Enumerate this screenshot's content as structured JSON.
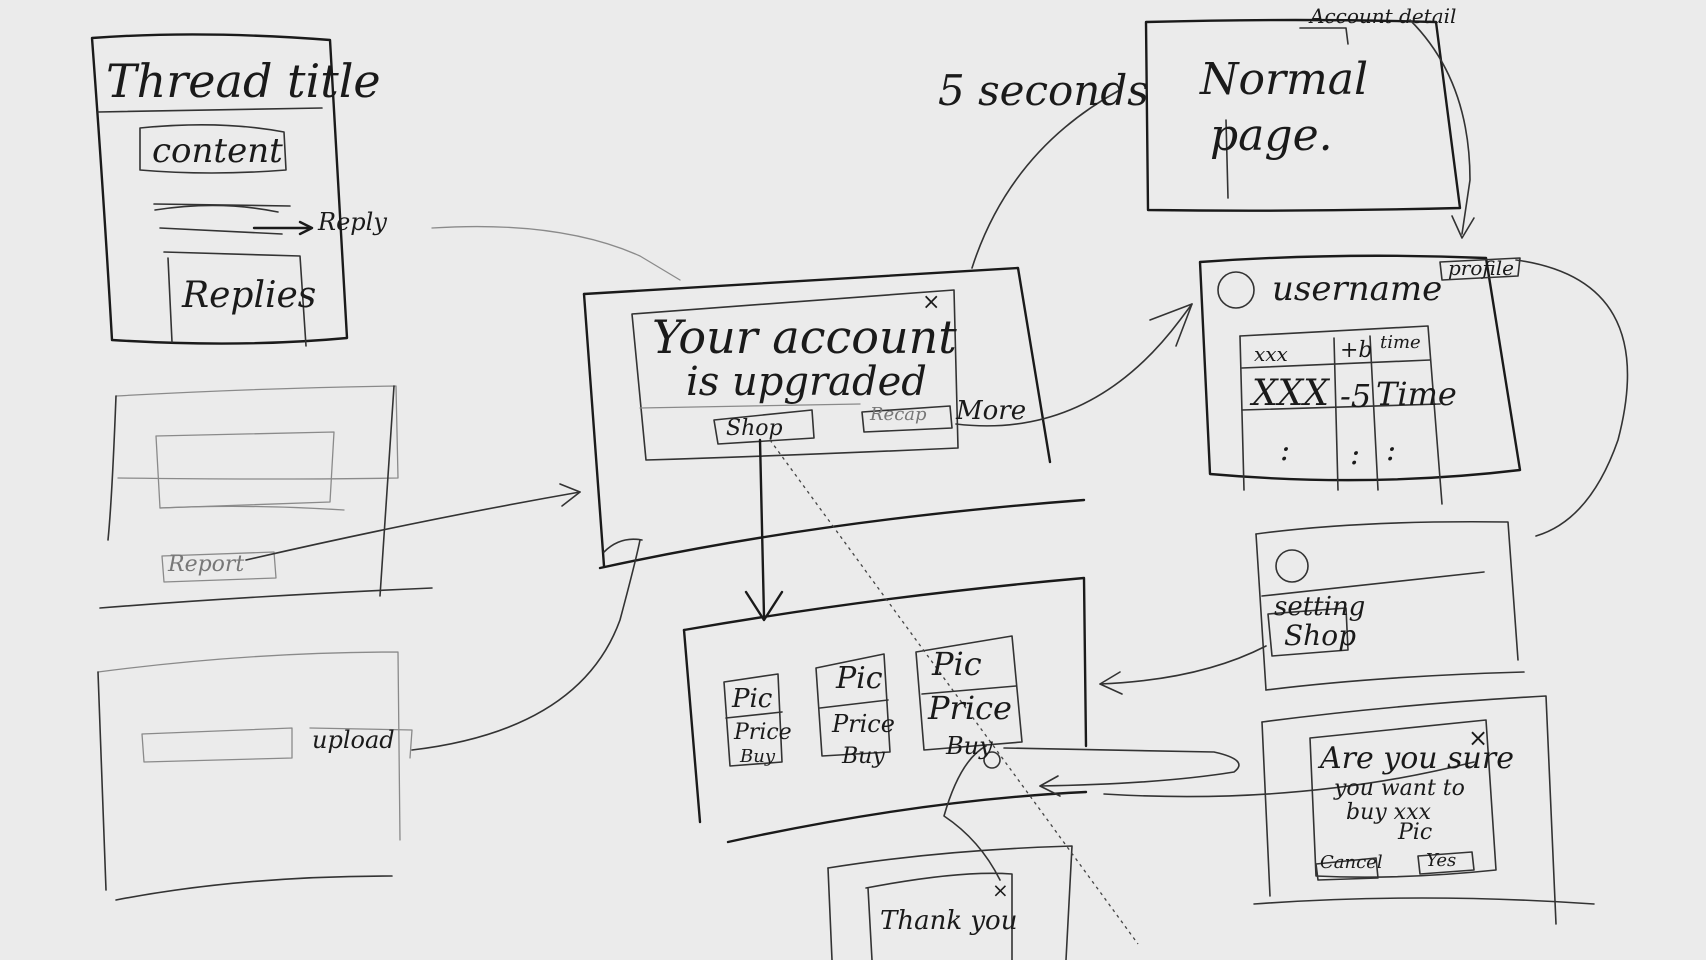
{
  "thread_page": {
    "title": "Thread title",
    "content": "content",
    "reply": "Reply",
    "replies": "Replies"
  },
  "report_page": {
    "report": "Report"
  },
  "upload_page": {
    "upload": "upload"
  },
  "timer": {
    "text": "5 seconds"
  },
  "normal_page": {
    "line1": "Normal",
    "line2": "page.",
    "account_detail": "Account detail"
  },
  "upgrade_modal": {
    "line1": "Your account",
    "line2": "is upgraded",
    "shop_button": "Shop",
    "recap_button": "Recap",
    "more_link": "More",
    "close": "×"
  },
  "profile_page": {
    "username": "username",
    "profile_tag": "profile",
    "table_headers": [
      "xxx",
      "+b",
      "time"
    ],
    "table_row": [
      "XXX",
      "-5",
      "Time"
    ],
    "ellipsis": ":"
  },
  "menu_page": {
    "setting": "setting",
    "shop": "Shop"
  },
  "shop_page": {
    "items": [
      {
        "pic": "Pic",
        "price": "Price",
        "buy": "Buy"
      },
      {
        "pic": "Pic",
        "price": "Price",
        "buy": "Buy"
      },
      {
        "pic": "Pic",
        "price": "Price",
        "buy": "Buy"
      }
    ]
  },
  "confirm_dialog": {
    "line1": "Are you sure",
    "line2": "you want to",
    "line3": "buy xxx",
    "pic": "Pic",
    "cancel": "Cancel",
    "yes": "Yes",
    "close": "×"
  },
  "thanks_dialog": {
    "text": "Thank you",
    "close": "×"
  }
}
